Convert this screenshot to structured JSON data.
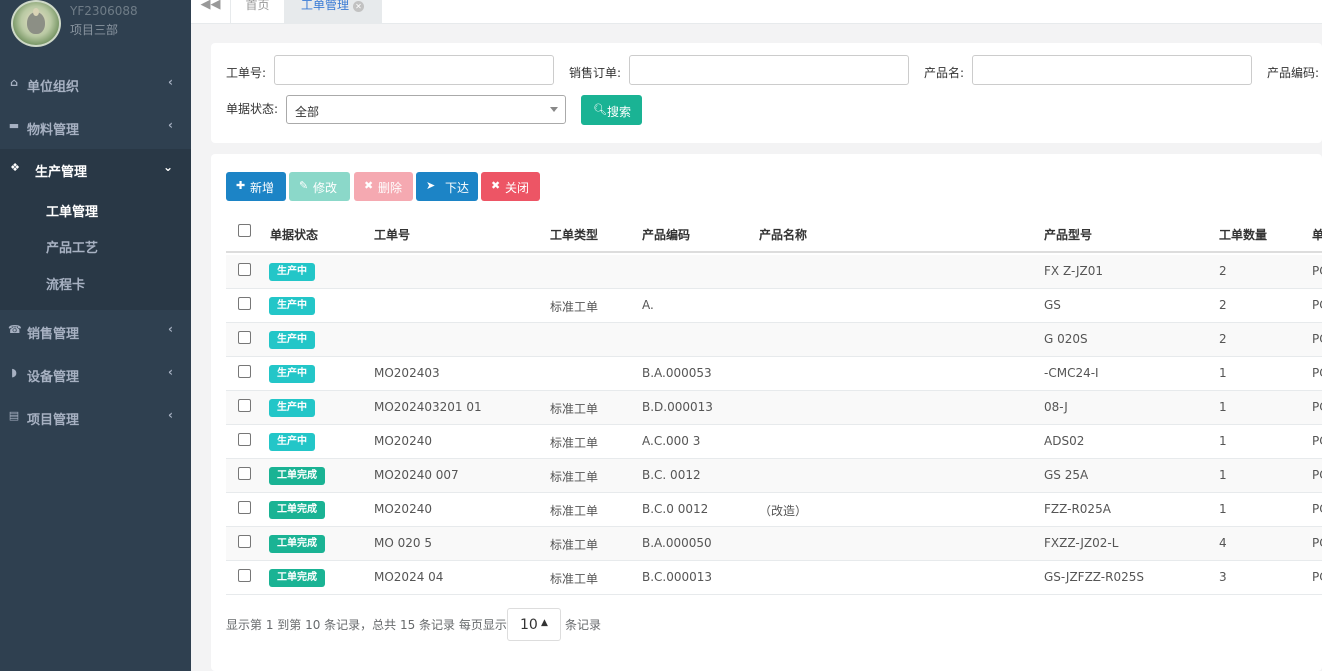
{
  "profile": {
    "user_id": "YF2306088",
    "department": "项目三部"
  },
  "sidebar": {
    "items": [
      {
        "label": "单位组织",
        "icon": "home-icon"
      },
      {
        "label": "物料管理",
        "icon": "folder-icon"
      },
      {
        "label": "生产管理",
        "icon": "cubes-icon"
      },
      {
        "label": "销售管理",
        "icon": "phone-icon"
      },
      {
        "label": "设备管理",
        "icon": "shield-icon"
      },
      {
        "label": "项目管理",
        "icon": "file-icon"
      }
    ],
    "sub_items": [
      {
        "label": "工单管理"
      },
      {
        "label": "产品工艺"
      },
      {
        "label": "流程卡"
      }
    ]
  },
  "tabs": {
    "home": "首页",
    "active": "工单管理"
  },
  "search": {
    "labels": {
      "order_no": "工单号:",
      "sales_order": "销售订单:",
      "product_name": "产品名:",
      "product_code": "产品编码:",
      "doc_status": "单据状态:"
    },
    "status_value": "全部",
    "search_button": "搜索"
  },
  "toolbar": {
    "add": "新增",
    "edit": "修改",
    "delete": "删除",
    "issue": "下达",
    "close": "关闭"
  },
  "table": {
    "headers": [
      "单据状态",
      "工单号",
      "工单类型",
      "产品编码",
      "产品名称",
      "产品型号",
      "工单数量",
      "单"
    ],
    "rows": [
      {
        "status": "生产中",
        "status_type": "inprod",
        "order_no": "",
        "type": "",
        "code": "",
        "name": "",
        "model": "FX Z-JZ01",
        "qty": "2",
        "unit": "PC"
      },
      {
        "status": "生产中",
        "status_type": "inprod",
        "order_no": "",
        "type": "标准工单",
        "code": "A.",
        "name": "",
        "model": "GS",
        "qty": "2",
        "unit": "PC"
      },
      {
        "status": "生产中",
        "status_type": "inprod",
        "order_no": "",
        "type": "",
        "code": "",
        "name": "",
        "model": "G 020S",
        "qty": "2",
        "unit": "PC"
      },
      {
        "status": "生产中",
        "status_type": "inprod",
        "order_no": "MO202403",
        "type": "",
        "code": "B.A.000053",
        "name": "",
        "model": "-CMC24-I",
        "qty": "1",
        "unit": "PC"
      },
      {
        "status": "生产中",
        "status_type": "inprod",
        "order_no": "MO202403201 01",
        "type": "标准工单",
        "code": "B.D.000013",
        "name": "",
        "model": "08-J",
        "qty": "1",
        "unit": "PC"
      },
      {
        "status": "生产中",
        "status_type": "inprod",
        "order_no": "MO20240",
        "type": "标准工单",
        "code": "A.C.000 3",
        "name": "",
        "model": "ADS02",
        "qty": "1",
        "unit": "PC"
      },
      {
        "status": "工单完成",
        "status_type": "done",
        "order_no": "MO20240 007",
        "type": "标准工单",
        "code": "B.C. 0012",
        "name": "",
        "model": "GS 25A",
        "qty": "1",
        "unit": "PC"
      },
      {
        "status": "工单完成",
        "status_type": "done",
        "order_no": "MO20240",
        "type": "标准工单",
        "code": "B.C.0 0012",
        "name": "（改造）",
        "model": "FZZ-R025A",
        "qty": "1",
        "unit": "PC"
      },
      {
        "status": "工单完成",
        "status_type": "done",
        "order_no": "MO 020 5",
        "type": "标准工单",
        "code": "B.A.000050",
        "name": "",
        "model": "FXZZ-JZ02-L",
        "qty": "4",
        "unit": "PC"
      },
      {
        "status": "工单完成",
        "status_type": "done",
        "order_no": "MO2024 04",
        "type": "标准工单",
        "code": "B.C.000013",
        "name": "",
        "model": "GS-JZFZZ-R025S",
        "qty": "3",
        "unit": "PC"
      }
    ]
  },
  "pager": {
    "summary": "显示第 1 到第 10 条记录，总共 15 条记录 每页显示",
    "page_size": "10",
    "suffix": "条记录"
  },
  "colors": {
    "sidebar": "#2f4050",
    "primary": "#1c84c6",
    "success": "#1ab394",
    "danger": "#ed5565",
    "info_badge": "#23c6c8"
  }
}
